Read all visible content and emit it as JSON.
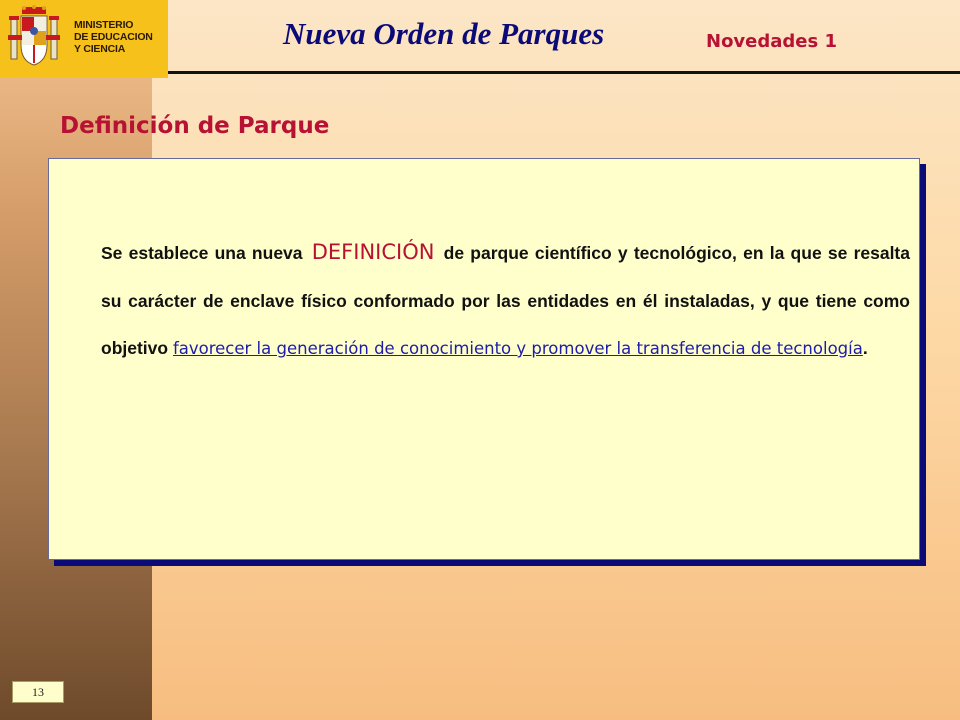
{
  "header": {
    "ministry_lines": [
      "MINISTERIO",
      "DE EDUCACION",
      "Y CIENCIA"
    ],
    "title": "Nueva Orden de Parques",
    "slide_tag": "Novedades 1",
    "logo_color": "#f6c11b"
  },
  "section": {
    "title": "Definición de Parque"
  },
  "content": {
    "intro": "Se establece una nueva ",
    "keyword": "DEFINICIÓN",
    "body": " de parque científico y tecnológico, en la que se resalta su carácter de enclave físico conformado por las entidades en él instaladas, y que tiene como objetivo ",
    "link": "favorecer la generación de conocimiento y promover la transferencia de tecnología",
    "end": "."
  },
  "footer": {
    "page_number": "13"
  },
  "colors": {
    "title_blue": "#0b0b78",
    "accent_red": "#b71233",
    "box_bg": "#ffffcc",
    "link_blue": "#1d1da8"
  }
}
